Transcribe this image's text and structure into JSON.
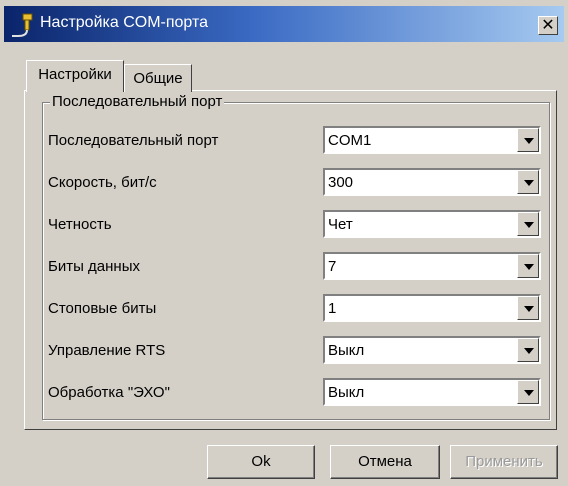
{
  "window": {
    "title": "Настройка COM-порта",
    "close": "✕"
  },
  "tabs": [
    {
      "label": "Настройки",
      "active": true
    },
    {
      "label": "Общие",
      "active": false
    }
  ],
  "group": {
    "legend": "Последовательный порт"
  },
  "settings": [
    {
      "label": "Последовательный порт",
      "value": "COM1"
    },
    {
      "label": "Скорость, бит/с",
      "value": "300"
    },
    {
      "label": "Четность",
      "value": "Чет"
    },
    {
      "label": "Биты данных",
      "value": "7"
    },
    {
      "label": "Стоповые биты",
      "value": "1"
    },
    {
      "label": "Управление RTS",
      "value": "Выкл"
    },
    {
      "label": "Обработка \"ЭХО\"",
      "value": "Выкл"
    }
  ],
  "buttons": {
    "ok": "Ok",
    "cancel": "Отмена",
    "apply": "Применить"
  },
  "icons": {
    "window_icon": "plug-icon",
    "dropdown": "chevron-down-icon"
  }
}
